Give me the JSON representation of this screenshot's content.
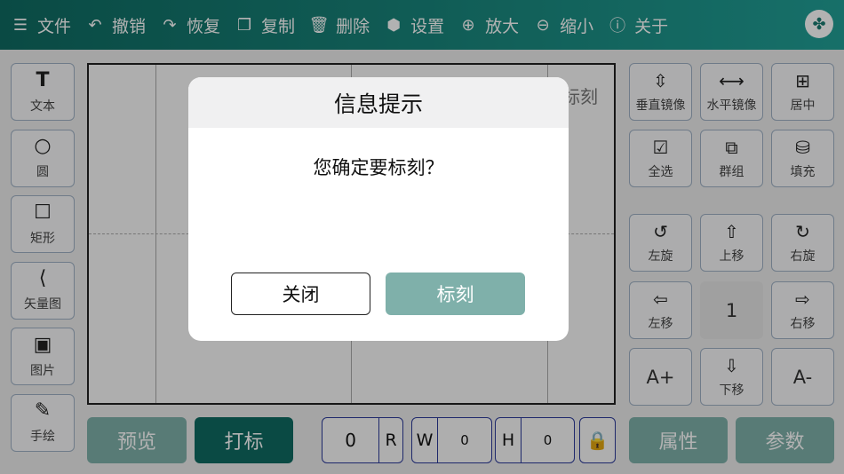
{
  "toolbar": {
    "file": "文件",
    "undo": "撤销",
    "redo": "恢复",
    "copy": "复制",
    "delete": "删除",
    "settings": "设置",
    "zoom_in": "放大",
    "zoom_out": "缩小",
    "about": "关于"
  },
  "left_tools": {
    "text": "文本",
    "circle": "圆",
    "rect": "矩形",
    "vector": "矢量图",
    "image": "图片",
    "draw": "手绘"
  },
  "canvas": {
    "label": "标刻"
  },
  "bottom": {
    "preview": "预览",
    "print": "打标",
    "rotate_value": "0",
    "rotate_label": "R",
    "width_label": "W",
    "width_value": "0",
    "height_label": "H",
    "height_value": "0",
    "attributes": "属性",
    "params": "参数"
  },
  "right_panel": {
    "vertical_mirror": "垂直镜像",
    "horizontal_mirror": "水平镜像",
    "center": "居中",
    "select_all": "全选",
    "group": "群组",
    "fill": "填充",
    "rotate_left": "左旋",
    "move_up": "上移",
    "rotate_right": "右旋",
    "move_left": "左移",
    "step": "1",
    "move_right": "右移",
    "font_bigger": "A+",
    "move_down": "下移",
    "font_smaller": "A-"
  },
  "dialog": {
    "title": "信息提示",
    "message": "您确定要标刻？",
    "close": "关闭",
    "confirm": "标刻"
  },
  "colors": {
    "toolbar_start": "#0f6b62",
    "accent_dark": "#0f6b62",
    "accent_light": "#7fb0aa",
    "field_border": "#2b3a9a"
  }
}
